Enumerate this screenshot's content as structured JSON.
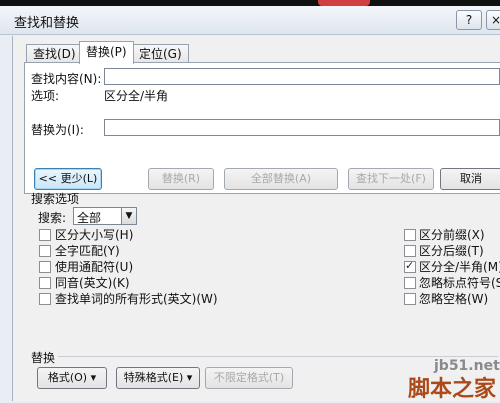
{
  "window": {
    "title": "查找和替换",
    "help": "?",
    "close": "×"
  },
  "tabs": [
    {
      "label": "查找(D)"
    },
    {
      "label": "替换(P)"
    },
    {
      "label": "定位(G)"
    }
  ],
  "find": {
    "label": "查找内容(N):",
    "value": "",
    "options_label": "选项:",
    "options_value": "区分全/半角"
  },
  "replace": {
    "label": "替换为(I):",
    "value": ""
  },
  "buttons": {
    "less": "<< 更少(L)",
    "replace": "替换(R)",
    "replace_all": "全部替换(A)",
    "find_next": "查找下一处(F)",
    "cancel": "取消"
  },
  "search_options": {
    "title": "搜索选项",
    "search_label": "搜索:",
    "search_value": "全部",
    "left": [
      {
        "label": "区分大小写(H)",
        "checked": false
      },
      {
        "label": "全字匹配(Y)",
        "checked": false
      },
      {
        "label": "使用通配符(U)",
        "checked": false
      },
      {
        "label": "同音(英文)(K)",
        "checked": false
      },
      {
        "label": "查找单词的所有形式(英文)(W)",
        "checked": false
      }
    ],
    "right": [
      {
        "label": "区分前缀(X)",
        "checked": false
      },
      {
        "label": "区分后缀(T)",
        "checked": false
      },
      {
        "label": "区分全/半角(M)",
        "checked": true
      },
      {
        "label": "忽略标点符号(S)",
        "checked": false
      },
      {
        "label": "忽略空格(W)",
        "checked": false
      }
    ]
  },
  "replace_section": {
    "title": "替换",
    "format": "格式(O) ▾",
    "special": "特殊格式(E) ▾",
    "no_format": "不限定格式(T)"
  },
  "watermark": {
    "line1": "jb51.net",
    "line2": "脚本之家"
  }
}
